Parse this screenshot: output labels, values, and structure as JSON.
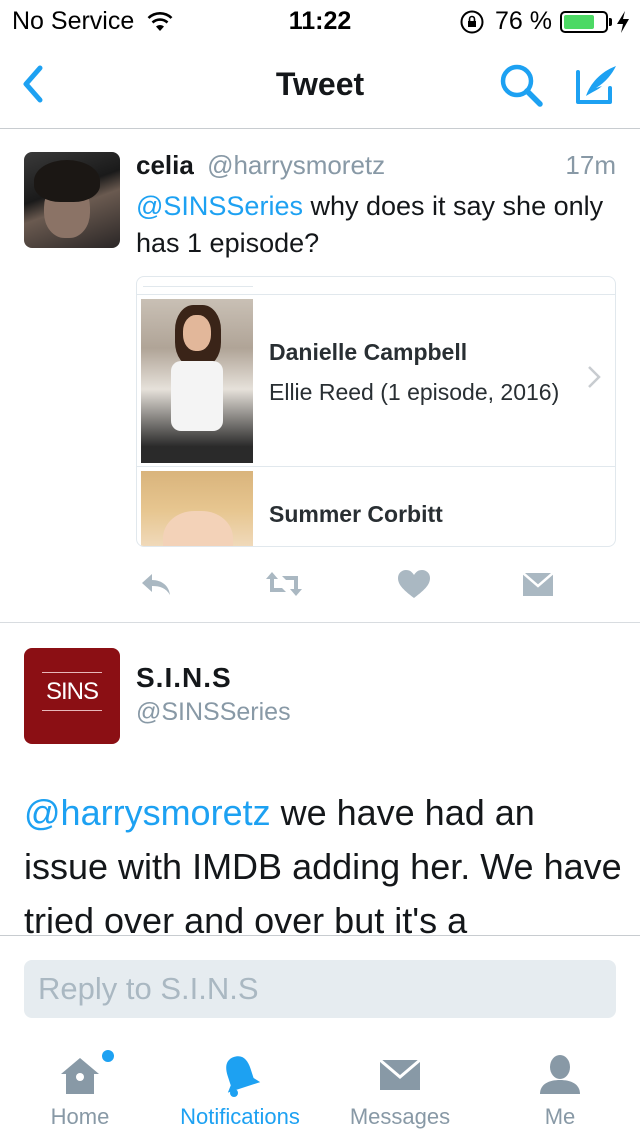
{
  "status_bar": {
    "carrier": "No Service",
    "time": "11:22",
    "battery_percent": "76 %",
    "battery_level": 0.76
  },
  "navbar": {
    "title": "Tweet",
    "back_icon": "chevron-left-icon",
    "search_icon": "search-icon",
    "compose_icon": "compose-tweet-icon"
  },
  "tweet1": {
    "name": "celia",
    "handle": "@harrysmoretz",
    "time": "17m",
    "mention": "@SINSSeries",
    "text": " why does it say she only has 1 episode?",
    "card": {
      "row1": {
        "name": "Danielle Campbell",
        "role": "Ellie Reed (1 episode, 2016)"
      },
      "row2": {
        "name": "Summer Corbitt"
      }
    },
    "actions": [
      "reply-icon",
      "retweet-icon",
      "like-icon",
      "direct-message-icon"
    ]
  },
  "tweet2": {
    "name": "S.I.N.S",
    "handle": "@SINSSeries",
    "avatar_text": "SINS",
    "mention": "@harrysmoretz",
    "text": " we have had an issue with IMDB adding her. We have tried over and over but it's a"
  },
  "reply": {
    "placeholder": "Reply to S.I.N.S"
  },
  "tabbar": {
    "items": [
      {
        "label": "Home",
        "icon": "home-icon"
      },
      {
        "label": "Notifications",
        "icon": "bell-icon"
      },
      {
        "label": "Messages",
        "icon": "envelope-icon"
      },
      {
        "label": "Me",
        "icon": "person-icon"
      }
    ]
  },
  "colors": {
    "accent": "#1da1f2",
    "muted": "#8899a6",
    "sins_brand": "#8b0f14"
  }
}
